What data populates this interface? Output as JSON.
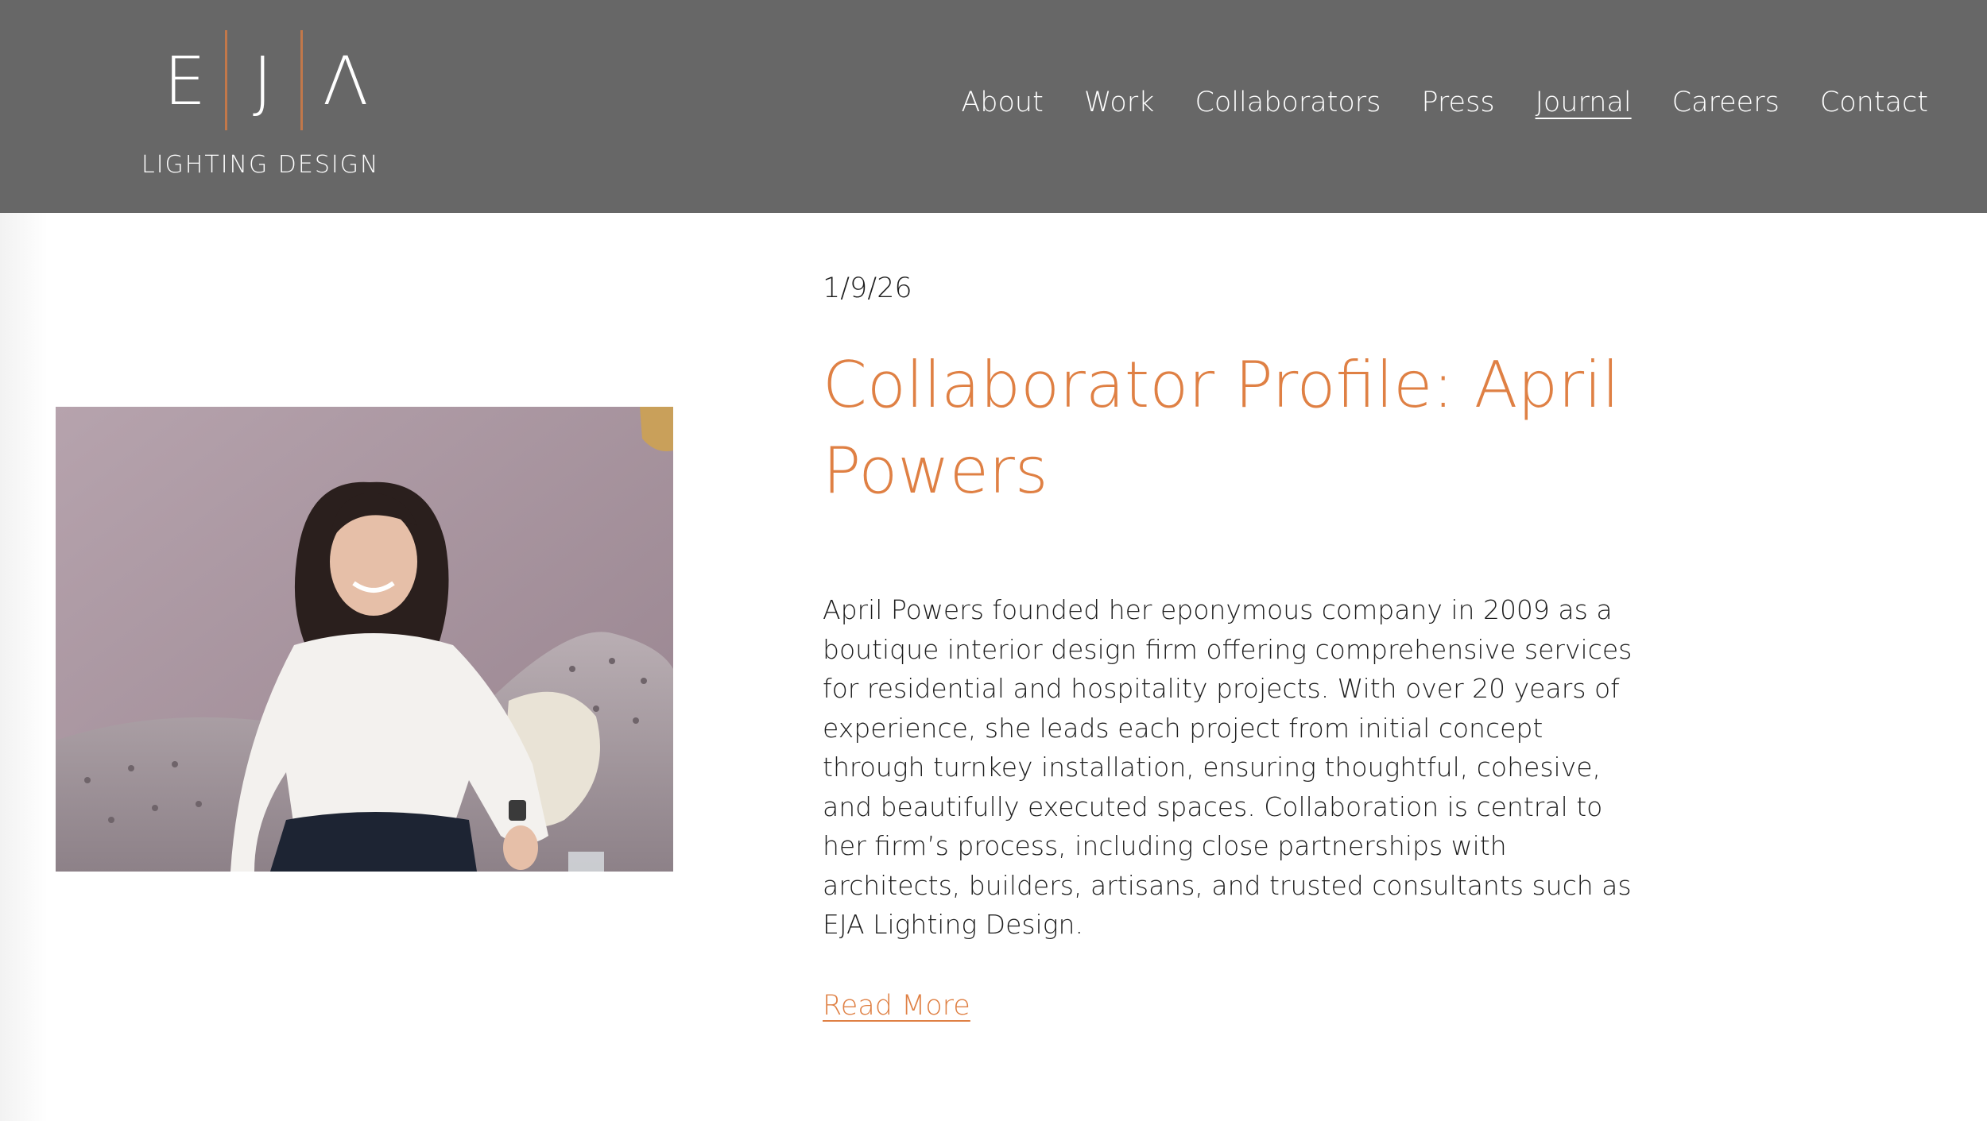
{
  "brand": {
    "logo_letters": [
      "E",
      "J",
      "Λ"
    ],
    "logo_subtitle": "LIGHTING DESIGN",
    "header_bg": "#676767",
    "accent": "#df8044"
  },
  "nav": {
    "items": [
      {
        "label": "About"
      },
      {
        "label": "Work"
      },
      {
        "label": "Collaborators"
      },
      {
        "label": "Press"
      },
      {
        "label": "Journal",
        "active": true
      },
      {
        "label": "Careers"
      },
      {
        "label": "Contact"
      }
    ]
  },
  "post": {
    "date": "1/9/26",
    "title": "Collaborator Profile: April Powers",
    "excerpt": "April Powers founded her eponymous company in 2009 as a boutique interior design firm offering comprehensive services for residential and hospitality projects. With over 20 years of experience, she leads each project from initial concept through turnkey installation, ensuring thoughtful, cohesive, and beautifully executed spaces. Collaboration is central to her firm’s process, including close partnerships with architects, builders, artisans, and trusted consultants such as EJA Lighting Design.",
    "read_more": "Read More"
  }
}
